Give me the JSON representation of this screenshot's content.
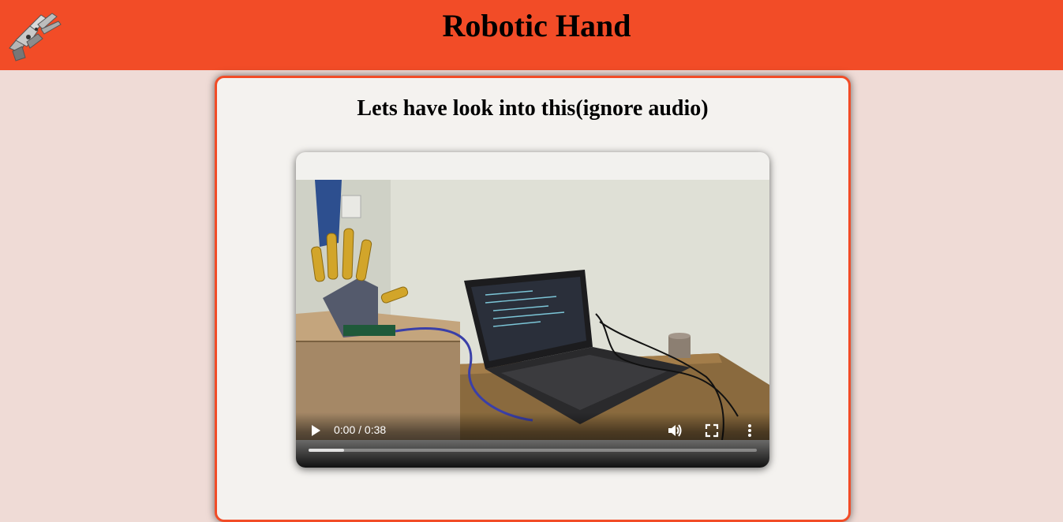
{
  "header": {
    "title": "Robotic Hand",
    "logo_icon": "robotic-hand-logo-icon",
    "background": "#f24c27"
  },
  "main": {
    "heading": "Lets have look into this(ignore audio)",
    "card_border": "#f24c27",
    "video": {
      "time": "0:00 / 0:38",
      "buffered_fraction": 0.08,
      "controls": {
        "play_icon": "play-icon",
        "volume_icon": "volume-icon",
        "fullscreen_icon": "fullscreen-icon",
        "more_icon": "more-options-icon"
      }
    }
  },
  "colors": {
    "page_background": "#efdbd6",
    "card_background": "#f4f2ef"
  }
}
